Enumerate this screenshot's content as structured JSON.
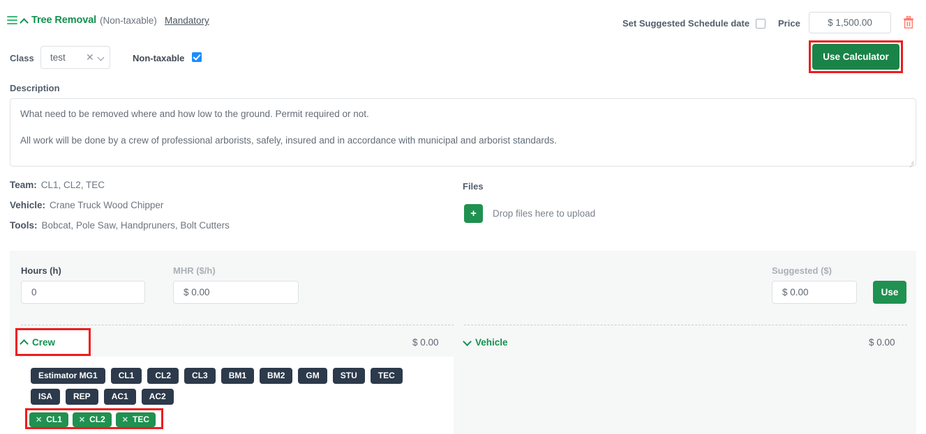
{
  "header": {
    "menu_icon": "hamburger-icon",
    "collapse_icon": "chevron-up-icon",
    "title": "Tree Removal",
    "tax_note": "(Non-taxable)",
    "mandatory_link": "Mandatory",
    "schedule_label": "Set Suggested Schedule date",
    "schedule_checked": false,
    "price_label": "Price",
    "price_value": "$ 1,500.00",
    "delete_icon": "trash-icon"
  },
  "class_row": {
    "class_label": "Class",
    "class_value": "test",
    "clear_icon": "close-icon",
    "dropdown_icon": "chevron-down-icon",
    "nontaxable_label": "Non-taxable",
    "nontaxable_checked": true,
    "calculator_button": "Use Calculator"
  },
  "description": {
    "label": "Description",
    "paragraph_1": "What need to be removed where and how low to the ground. Permit required or not.",
    "paragraph_2": "All work will be done by a crew of professional arborists, safely, insured and in accordance with municipal and arborist standards."
  },
  "meta": [
    {
      "key": "Team:",
      "value": "CL1, CL2, TEC"
    },
    {
      "key": "Vehicle:",
      "value": "Crane Truck Wood Chipper"
    },
    {
      "key": "Tools:",
      "value": "Bobcat, Pole Saw, Handpruners, Bolt Cutters"
    }
  ],
  "files": {
    "label": "Files",
    "plus_icon": "plus-icon",
    "drop_text": "Drop files here to upload"
  },
  "calculator": {
    "hours_label": "Hours (h)",
    "hours_value": "0",
    "mhr_label": "MHR ($/h)",
    "mhr_value": "$ 0.00",
    "suggested_label": "Suggested ($)",
    "suggested_value": "$ 0.00",
    "use_button": "Use"
  },
  "crew_section": {
    "toggle_icon": "chevron-up-icon",
    "title": "Crew",
    "amount": "$ 0.00",
    "available": [
      [
        "Estimator MG1",
        "CL1",
        "CL2",
        "CL3",
        "BM1",
        "BM2",
        "GM",
        "STU",
        "TEC"
      ],
      [
        "ISA",
        "REP",
        "AC1",
        "AC2"
      ]
    ],
    "selected": [
      "CL1",
      "CL2",
      "TEC"
    ],
    "remove_icon": "close-icon"
  },
  "vehicle_section": {
    "toggle_icon": "chevron-down-icon",
    "title": "Vehicle",
    "amount": "$ 0.00"
  },
  "colors": {
    "brand_green": "#12914f",
    "button_green": "#1f9150",
    "dark_chip": "#2c3a4b",
    "highlight_red": "#ee1c1c",
    "checkbox_blue": "#1a8cff",
    "panel_gray": "#f6f7f7"
  }
}
